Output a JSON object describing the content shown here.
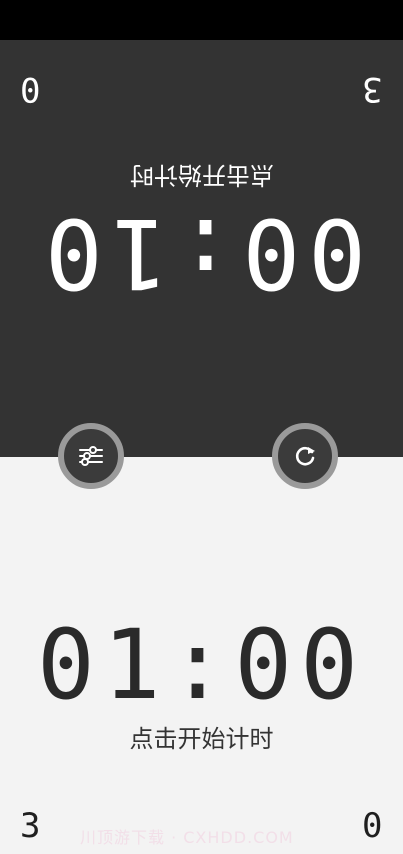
{
  "top": {
    "left_score": "0",
    "right_score": "3",
    "hint": "点击开始计时",
    "timer": "00:10"
  },
  "bottom": {
    "left_score": "3",
    "right_score": "0",
    "hint": "点击开始计时",
    "timer": "01:00"
  },
  "buttons": {
    "settings_icon": "sliders-icon",
    "reset_icon": "refresh-icon"
  },
  "watermark": "川顶游下载 · CXHDD.COM"
}
